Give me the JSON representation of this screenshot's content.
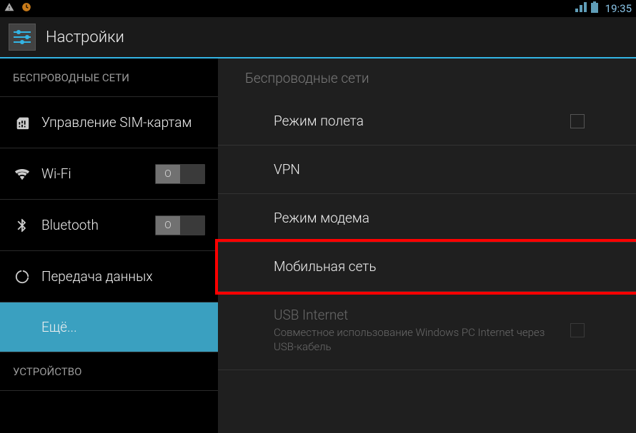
{
  "status": {
    "time": "19:35"
  },
  "header": {
    "title": "Настройки"
  },
  "sidebar": {
    "section_wireless": "БЕСПРОВОДНЫЕ СЕТИ",
    "section_device": "УСТРОЙСТВО",
    "items": {
      "sim": "Управление SIM-картам",
      "wifi": "Wi-Fi",
      "bluetooth": "Bluetooth",
      "data": "Передача данных",
      "more": "Ещё..."
    }
  },
  "main": {
    "section": "Беспроводные сети",
    "airplane": "Режим полета",
    "vpn": "VPN",
    "tether": "Режим модема",
    "mobile": "Мобильная сеть",
    "usb": {
      "title": "USB Internet",
      "subtitle": "Совместное использование Windows PC Internet через USB-кабель"
    }
  }
}
